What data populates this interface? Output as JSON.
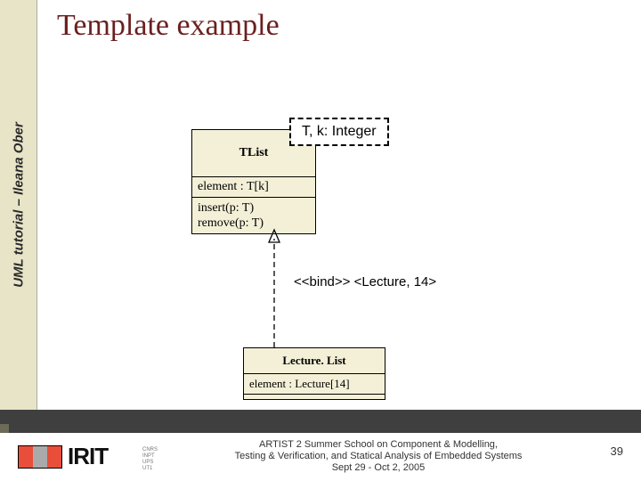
{
  "sidebar": {
    "label": "UML tutorial – Ileana Ober"
  },
  "title": "Template example",
  "tlist": {
    "name": "TList",
    "params": "T, k: Integer",
    "attr": "element : T[k]",
    "op1": "insert(p: T)",
    "op2": "remove(p: T)"
  },
  "bind": {
    "label": "<<bind>> <Lecture, 14>"
  },
  "lecturelist": {
    "name": "Lecture. List",
    "attr": "element : Lecture[14]"
  },
  "footer": {
    "line1": "ARTIST 2 Summer School on Component & Modelling,",
    "line2": "Testing & Verification, and Statical Analysis of Embedded Systems",
    "line3": "Sept 29 - Oct 2, 2005",
    "affil": "CNRS\nINPT\nUPS\nUT1",
    "irit": "IRIT",
    "page": "39"
  }
}
